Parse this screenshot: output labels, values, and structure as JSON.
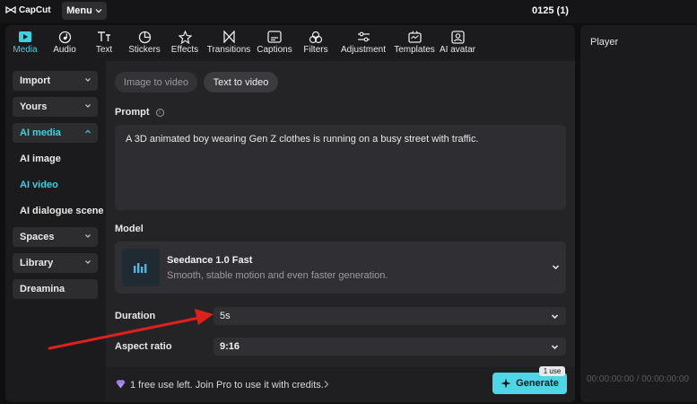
{
  "app": {
    "logo_text": "CapCut",
    "menu_label": "Menu",
    "project_title": "0125 (1)"
  },
  "tabs": [
    {
      "label": "Media",
      "icon": "media-icon",
      "active": true
    },
    {
      "label": "Audio",
      "icon": "audio-icon"
    },
    {
      "label": "Text",
      "icon": "text-icon"
    },
    {
      "label": "Stickers",
      "icon": "stickers-icon"
    },
    {
      "label": "Effects",
      "icon": "effects-icon"
    },
    {
      "label": "Transitions",
      "icon": "transitions-icon"
    },
    {
      "label": "Captions",
      "icon": "captions-icon"
    },
    {
      "label": "Filters",
      "icon": "filters-icon"
    },
    {
      "label": "Adjustment",
      "icon": "adjustment-icon"
    },
    {
      "label": "Templates",
      "icon": "templates-icon"
    },
    {
      "label": "AI avatar",
      "icon": "ai-avatar-icon"
    }
  ],
  "sidebar": {
    "items": [
      {
        "label": "Import"
      },
      {
        "label": "Yours"
      },
      {
        "label": "AI media"
      },
      {
        "label": "AI image"
      },
      {
        "label": "AI video"
      },
      {
        "label": "AI dialogue scene"
      },
      {
        "label": "Spaces"
      },
      {
        "label": "Library"
      },
      {
        "label": "Dreamina"
      }
    ]
  },
  "mode": {
    "image_to_video": "Image to video",
    "text_to_video": "Text to video"
  },
  "prompt": {
    "label": "Prompt",
    "value": "A 3D animated boy wearing Gen Z clothes is running on a busy street with traffic."
  },
  "model": {
    "label": "Model",
    "name": "Seedance 1.0 Fast",
    "description": "Smooth, stable motion and even faster generation."
  },
  "duration": {
    "label": "Duration",
    "value": "5s"
  },
  "aspect_ratio": {
    "label": "Aspect ratio",
    "value": "9:16"
  },
  "footer": {
    "free_text": "1 free use left. Join Pro to use it with credits.",
    "generate_label": "Generate",
    "badge": "1 use"
  },
  "player": {
    "title": "Player",
    "timecode": "00:00:00:00 / 00:00:00:00"
  },
  "colors": {
    "accent": "#3ad1e0",
    "annotation_arrow": "#e0201c",
    "generate_button": "#4fd6e6"
  }
}
